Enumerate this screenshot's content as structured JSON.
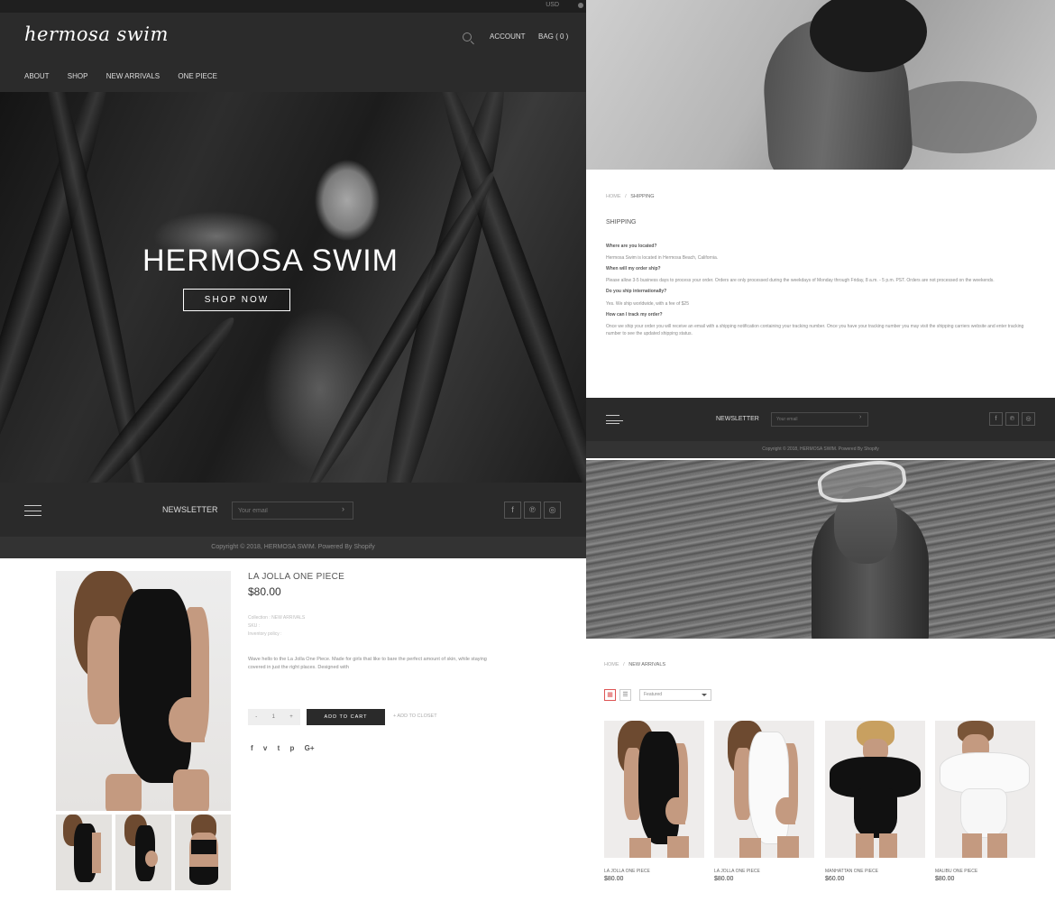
{
  "store": {
    "currency": "USD",
    "logo": "hermosa swim",
    "account_label": "ACCOUNT",
    "bag_label": "BAG ( 0 )",
    "nav": [
      "ABOUT",
      "SHOP",
      "NEW ARRIVALS",
      "ONE PIECE"
    ]
  },
  "hero": {
    "title": "HERMOSA SWIM",
    "button_label": "SHOP NOW"
  },
  "footer": {
    "newsletter_label": "NEWSLETTER",
    "email_placeholder": "Your email",
    "copyright": "Copyright © 2018, HERMOSA SWIM. Powered By Shopify",
    "social_icons": [
      "facebook-icon",
      "pinterest-icon",
      "instagram-icon"
    ]
  },
  "product": {
    "title": "LA JOLLA ONE PIECE",
    "price": "$80.00",
    "collection": "Collection : NEW ARRIVALS",
    "sku": "SKU :",
    "inventory": "Inventory policy :",
    "description": "Wave hello to the La Jolla One Piece. Made for girls that like to bare the perfect amount of skin, while staying covered in just the right places. Designed with",
    "qty_minus": "-",
    "qty_value": "1",
    "qty_plus": "+",
    "add_to_cart": "ADD TO CART",
    "add_to_closet": "+ ADD TO CLOSET",
    "share_icons": [
      "f",
      "v",
      "t",
      "p",
      "G+"
    ]
  },
  "shipping": {
    "breadcrumb_home": "HOME",
    "breadcrumb_sep": "/",
    "breadcrumb_current": "SHIPPING",
    "heading": "SHIPPING",
    "faq": [
      {
        "q": "Where are you located?",
        "a": "Hermosa Swim is located in Hermosa Beach, California."
      },
      {
        "q": "When will my order ship?",
        "a": "Please allow 3-5 business days to process your order. Orders are only processed during the weekdays of Monday through Friday, 8 a.m. - 5 p.m. PST. Orders are not processed on the weekends."
      },
      {
        "q": "Do you ship internationally?",
        "a": "Yes. We ship worldwide, with a fee of $25"
      },
      {
        "q": "How can I track my order?",
        "a": "Once we ship your order you will receive an email with a shipping notification containing your tracking number. Once you have your tracking number you may visit the shipping carriers website and enter tracking number to see the updated shipping status."
      }
    ]
  },
  "collection": {
    "breadcrumb_home": "HOME",
    "breadcrumb_sep": "/",
    "breadcrumb_current": "NEW ARRIVALS",
    "grid_icon": "grid-icon",
    "list_icon": "list-icon",
    "sort_value": "Featured",
    "products": [
      {
        "name": "LA JOLLA ONE PIECE",
        "price": "$80.00"
      },
      {
        "name": "LA JOLLA ONE PIECE",
        "price": "$80.00"
      },
      {
        "name": "MANHATTAN ONE PIECE",
        "price": "$60.00"
      },
      {
        "name": "MALIBU ONE PIECE",
        "price": "$80.00"
      }
    ]
  }
}
